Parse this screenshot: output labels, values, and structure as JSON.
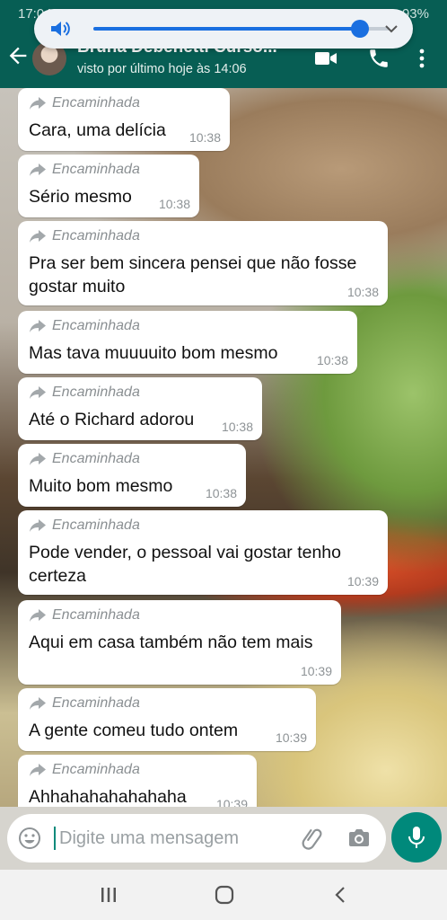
{
  "status_bar": {
    "time": "17:04",
    "battery": "93%"
  },
  "header": {
    "contact_name": "Bruna Debenetti Curso...",
    "last_seen": "visto por último hoje às 14:06"
  },
  "volume_overlay": {
    "level": 0.9
  },
  "messages": [
    {
      "forwarded_label": "Encaminhada",
      "lines": [
        "Cara, uma delícia"
      ],
      "time": "10:38"
    },
    {
      "forwarded_label": "Encaminhada",
      "lines": [
        "Sério mesmo"
      ],
      "time": "10:38"
    },
    {
      "forwarded_label": "Encaminhada",
      "lines": [
        "Pra ser bem sincera pensei que não fosse",
        "gostar muito"
      ],
      "time": "10:38"
    },
    {
      "forwarded_label": "Encaminhada",
      "lines": [
        "Mas tava muuuuito bom mesmo"
      ],
      "time": "10:38"
    },
    {
      "forwarded_label": "Encaminhada",
      "lines": [
        "Até o Richard adorou"
      ],
      "time": "10:38"
    },
    {
      "forwarded_label": "Encaminhada",
      "lines": [
        "Muito bom mesmo"
      ],
      "time": "10:38"
    },
    {
      "forwarded_label": "Encaminhada",
      "lines": [
        "Pode vender, o pessoal vai gostar tenho",
        "certeza"
      ],
      "time": "10:39"
    },
    {
      "forwarded_label": "Encaminhada",
      "lines": [
        "Aqui em casa também não tem mais"
      ],
      "time": "10:39"
    },
    {
      "forwarded_label": "Encaminhada",
      "lines": [
        "A gente comeu tudo ontem"
      ],
      "time": "10:39"
    },
    {
      "forwarded_label": "Encaminhada",
      "lines": [
        "Ahhahahahahahaha"
      ],
      "time": "10:39"
    }
  ],
  "composer": {
    "placeholder": "Digite uma mensagem"
  },
  "colors": {
    "header": "#075e54",
    "accent": "#00897b",
    "bubble": "#ffffff",
    "volume_accent": "#1a6fe0"
  },
  "icons": [
    "back-arrow-icon",
    "video-call-icon",
    "phone-icon",
    "more-vert-icon",
    "speaker-icon",
    "chevron-down-icon",
    "forward-icon",
    "double-chevron-down-icon",
    "emoji-icon",
    "paperclip-icon",
    "camera-icon",
    "mic-icon",
    "recent-apps-icon",
    "home-icon",
    "nav-back-icon"
  ]
}
